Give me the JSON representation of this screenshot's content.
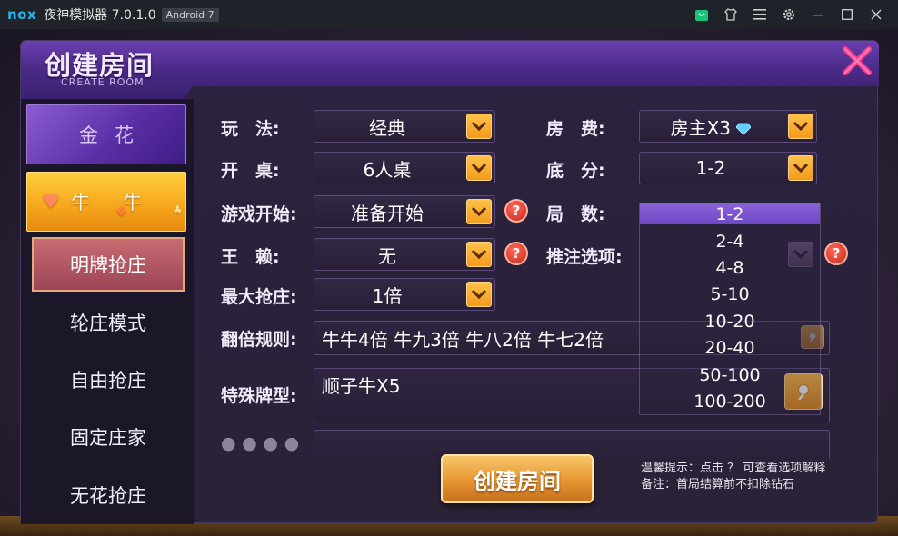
{
  "window": {
    "logo": "nox",
    "title": "夜神模拟器 7.0.1.0",
    "android_badge": "Android 7",
    "icons": [
      "shop-bag-icon",
      "shirt-icon",
      "menu-icon",
      "gear-icon",
      "minimize-icon",
      "maximize-icon",
      "close-icon"
    ]
  },
  "header": {
    "title": "创建房间",
    "subtitle": "CREATE ROOM"
  },
  "sidebar": {
    "categories": [
      {
        "label": "金花"
      },
      {
        "label": "牛牛"
      }
    ],
    "modes": [
      {
        "label": "明牌抢庄"
      },
      {
        "label": "轮庄模式"
      },
      {
        "label": "自由抢庄"
      },
      {
        "label": "固定庄家"
      },
      {
        "label": "无花抢庄"
      }
    ]
  },
  "form": {
    "play_label": "玩　法:",
    "play_value": "经典",
    "table_label": "开　桌:",
    "table_value": "6人桌",
    "start_label": "游戏开始:",
    "start_value": "准备开始",
    "wildcard_label": "王　赖:",
    "wildcard_value": "无",
    "max_grab_label": "最大抢庄:",
    "max_grab_value": "1倍",
    "double_rule_label": "翻倍规则:",
    "double_rule_value": "牛牛4倍 牛九3倍 牛八2倍 牛七2倍",
    "special_label": "特殊牌型:",
    "special_value": "顺子牛X5",
    "room_fee_label": "房　费:",
    "room_fee_value": "房主X3",
    "base_score_label": "底　分:",
    "base_score_value": "1-2",
    "rounds_label": "局　数:",
    "bet_option_label": "推注选项:",
    "help_glyph": "?"
  },
  "dropdown": {
    "options": [
      "1-2",
      "2-4",
      "4-8",
      "5-10",
      "10-20",
      "20-40",
      "50-100",
      "100-200"
    ],
    "selected": "1-2"
  },
  "footer": {
    "create_button": "创建房间",
    "tip_line1": "温馨提示：点击 ？ 可查看选项解释",
    "tip_line2": "备注：首局结算前不扣除钻石"
  },
  "colors": {
    "accent_orange": "#f19b1d",
    "header_purple": "#5a32a0",
    "active_mode": "#b05866",
    "help_red": "#d9342a"
  }
}
